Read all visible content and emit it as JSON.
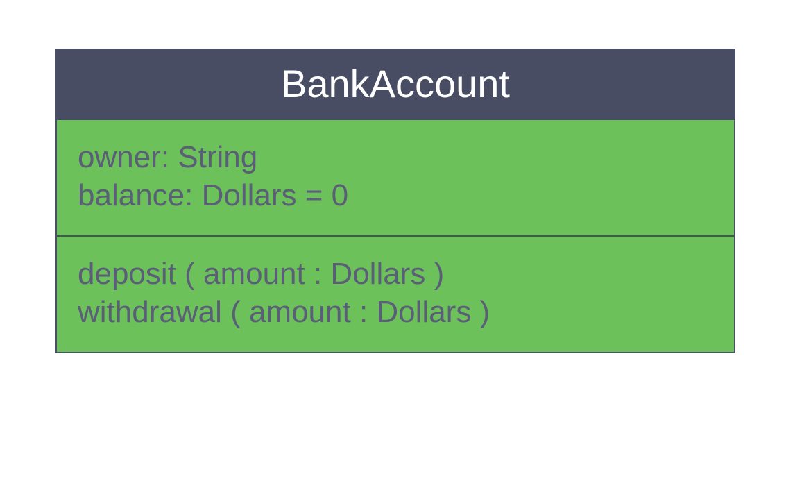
{
  "uml_class": {
    "name": "BankAccount",
    "attributes": [
      "owner: String",
      "balance: Dollars = 0"
    ],
    "methods": [
      "deposit ( amount : Dollars )",
      "withdrawal ( amount : Dollars )"
    ]
  }
}
